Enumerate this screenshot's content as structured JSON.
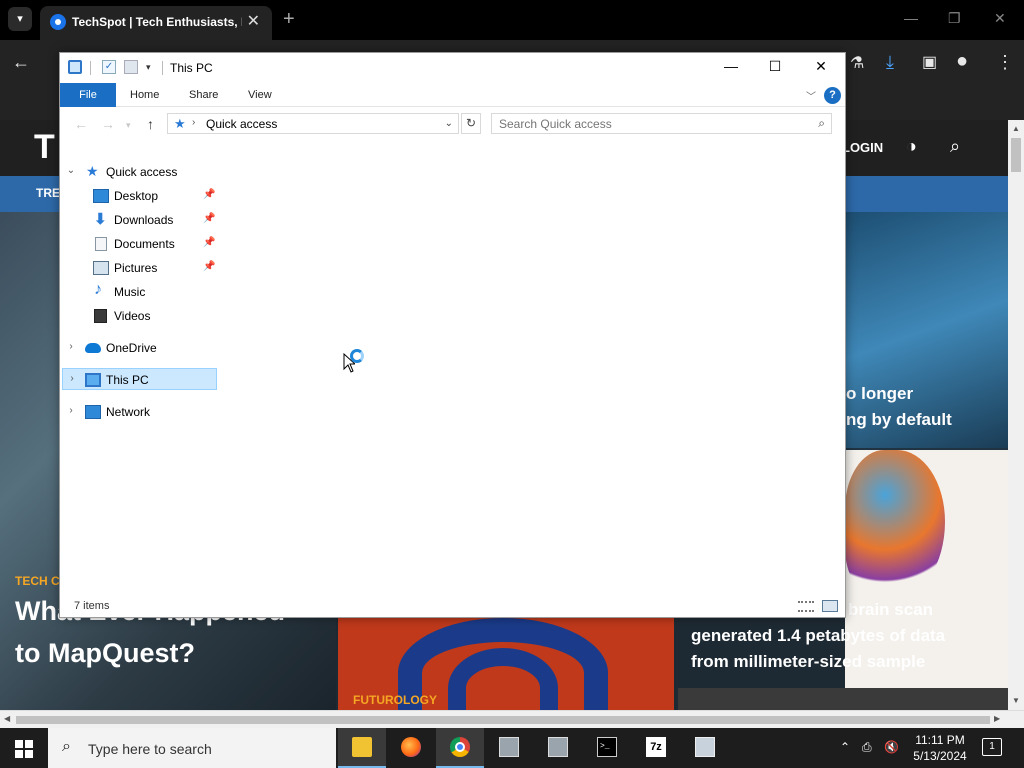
{
  "browser": {
    "tab_title": "TechSpot | Tech Enthusiasts, Po",
    "tab_close": "✕",
    "new_tab": "+"
  },
  "site": {
    "logo": "T",
    "login": "LOGIN",
    "nav_item": "TRE",
    "articles": [
      {
        "tag": "TECH C",
        "headline_line1": "What Ever Happened",
        "headline_line2": "to MapQuest?"
      },
      {
        "tag": "FUTUROLOGY"
      },
      {
        "headline_line1": "o longer",
        "headline_line2": "ng by default"
      },
      {
        "headline_line1": "brain scan",
        "headline_line2": "generated 1.4 petabytes of data",
        "headline_line3": "from millimeter-sized sample"
      }
    ]
  },
  "explorer": {
    "title": "This PC",
    "ribbon_tabs": [
      "File",
      "Home",
      "Share",
      "View"
    ],
    "help": "?",
    "address": "Quick access",
    "search_placeholder": "Search Quick access",
    "tree": {
      "quick_access": "Quick access",
      "children": [
        "Desktop",
        "Downloads",
        "Documents",
        "Pictures",
        "Music",
        "Videos"
      ],
      "onedrive": "OneDrive",
      "this_pc": "This PC",
      "network": "Network"
    },
    "status": "7 items"
  },
  "taskbar": {
    "search_text": "Type here to search",
    "apps": [
      "file-explorer",
      "firefox",
      "chrome",
      "virtualbox",
      "package-tool",
      "command-prompt",
      "7-zip",
      "server-manager"
    ],
    "term_label": ">_",
    "sevenzip_label": "7z",
    "time": "11:11 PM",
    "date": "5/13/2024",
    "notifications": "1"
  },
  "colors": {
    "accent": "#1a6fc4",
    "selection": "#cce8ff",
    "site_nav": "#2d69a8",
    "tag": "#f5a623"
  }
}
